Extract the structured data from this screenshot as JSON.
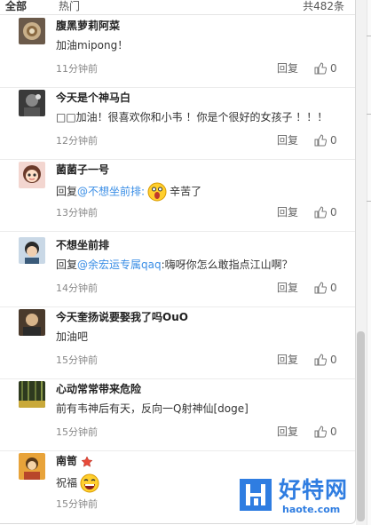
{
  "header": {
    "tab_all": "全部",
    "tab_hot": "热门",
    "total": "共482条"
  },
  "actions": {
    "reply_label": "回复"
  },
  "comments": [
    {
      "name": "腹黑萝莉阿菜",
      "text": "加油mipong！",
      "time": "11分钟前",
      "likes": "0"
    },
    {
      "name": "今天是个神马白",
      "text": "□□加油！很喜欢你和小韦 ！你是个很好的女孩子 ！！！",
      "time": "12分钟前",
      "likes": "0"
    },
    {
      "name": "菌菌子一号",
      "reply_prefix": "回复",
      "mention": "@不想坐前排:",
      "text_after": "辛苦了",
      "time": "13分钟前",
      "likes": "0"
    },
    {
      "name": "不想坐前排",
      "reply_prefix": "回复",
      "mention": "@余宏运专属qaq",
      "text_after": ":嗨呀你怎么敢指点江山啊？",
      "time": "14分钟前",
      "likes": "0"
    },
    {
      "name": "今天奎扬说要娶我了吗OuO",
      "text": "加油吧",
      "time": "15分钟前",
      "likes": "0"
    },
    {
      "name": "心动常常带来危险",
      "text": "前有韦神后有天，反向一Q射神仙[doge]",
      "time": "15分钟前",
      "likes": "0"
    },
    {
      "name": "南笥",
      "text": "祝福",
      "time": "15分钟前",
      "likes": "0"
    }
  ],
  "watermark": {
    "title": "好特网",
    "url": "haote.com"
  },
  "colors": {
    "mention": "#3a8ee6",
    "brand": "#2f7de1"
  }
}
